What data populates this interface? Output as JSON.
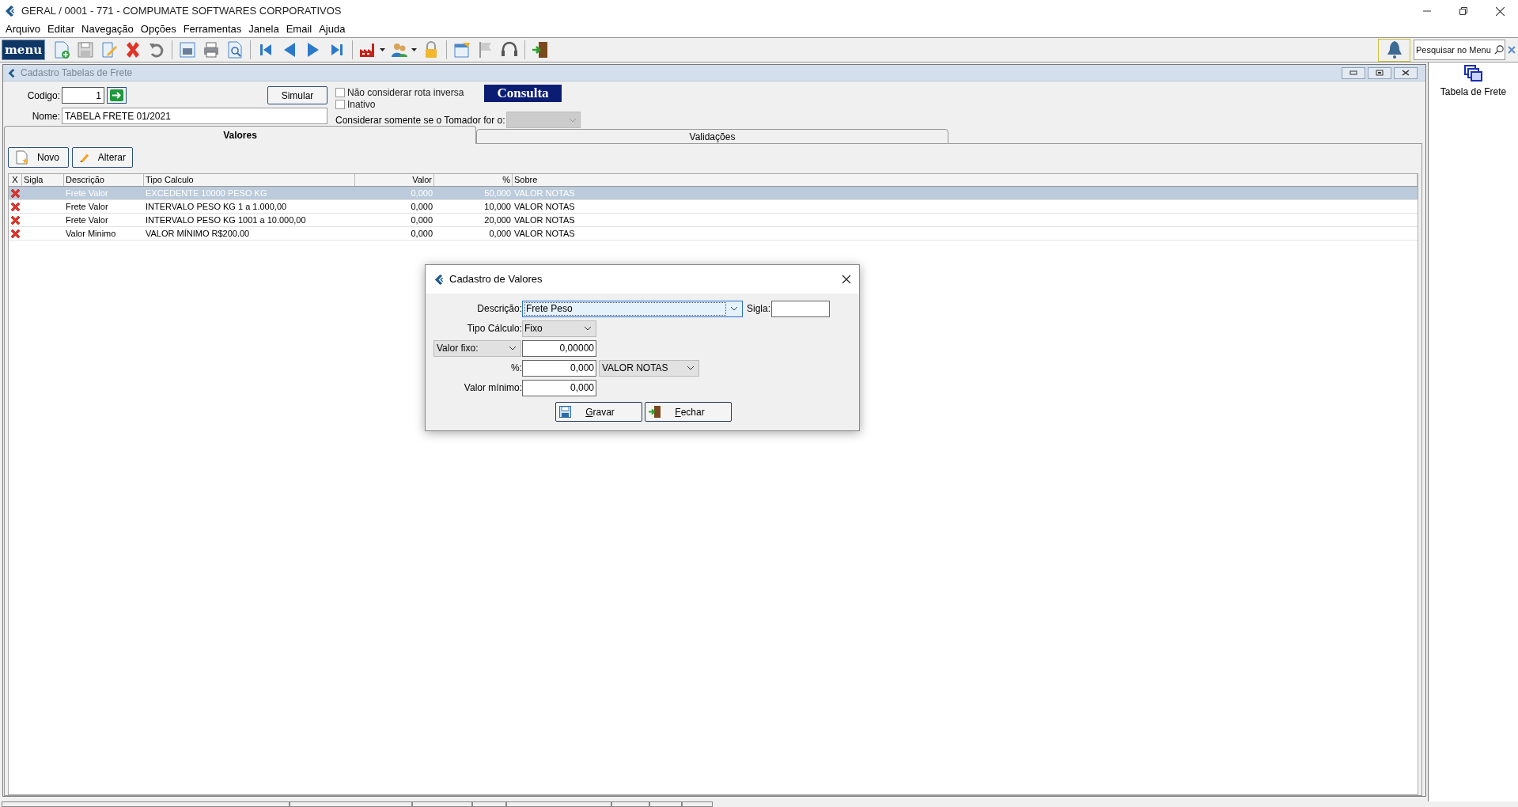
{
  "window": {
    "title": "GERAL / 0001 - 771 - COMPUMATE SOFTWARES CORPORATIVOS"
  },
  "menu": [
    "Arquivo",
    "Editar",
    "Navegação",
    "Opções",
    "Ferramentas",
    "Janela",
    "Email",
    "Ajuda"
  ],
  "toolbar": {
    "menu_button": "menu",
    "search": {
      "placeholder": "Pesquisar no Menu"
    }
  },
  "side_panel": {
    "items": [
      {
        "label": "Tabela de Frete"
      }
    ]
  },
  "child_window": {
    "title": "Cadastro Tabelas de Frete",
    "codigo": {
      "label": "Codigo:",
      "value": "1"
    },
    "nome": {
      "label": "Nome:",
      "value": "TABELA FRETE 01/2021"
    },
    "simular": "Simular",
    "options": [
      {
        "label": "Não considerar rota inversa",
        "checked": false
      },
      {
        "label": "Inativo",
        "checked": false
      }
    ],
    "mode_badge": "Consulta",
    "tomador": {
      "label": "Considerar somente se o Tomador for o:",
      "disabled": true
    },
    "tabs": [
      {
        "label": "Valores",
        "selected": true
      },
      {
        "label": "Validações",
        "selected": false
      }
    ],
    "buttons": [
      "Novo",
      "Alterar"
    ],
    "table": {
      "columns": [
        "X",
        "Sigla",
        "Descrição",
        "Tipo Calculo",
        "Valor",
        "%",
        "Sobre"
      ],
      "rows": [
        {
          "sigla": "",
          "descricao": "Frete Valor",
          "tipo": "EXCEDENTE 10000 PESO KG",
          "valor": "0,000",
          "pct": "50,000",
          "sobre": "VALOR NOTAS",
          "selected": true
        },
        {
          "sigla": "",
          "descricao": "Frete Valor",
          "tipo": "INTERVALO PESO KG 1 a 1.000,00",
          "valor": "0,000",
          "pct": "10,000",
          "sobre": "VALOR NOTAS",
          "selected": false
        },
        {
          "sigla": "",
          "descricao": "Frete Valor",
          "tipo": "INTERVALO PESO KG 1001 a 10.000,00",
          "valor": "0,000",
          "pct": "20,000",
          "sobre": "VALOR NOTAS",
          "selected": false
        },
        {
          "sigla": "",
          "descricao": "Valor Minimo",
          "tipo": "VALOR MÍNIMO R$200.00",
          "valor": "0,000",
          "pct": "0,000",
          "sobre": "VALOR NOTAS",
          "selected": false
        }
      ]
    }
  },
  "dialog": {
    "title": "Cadastro de Valores",
    "descricao": {
      "label": "Descrição:",
      "value": "Frete Peso"
    },
    "sigla": {
      "label": "Sigla:"
    },
    "tipo_calculo": {
      "label": "Tipo Cálculo:",
      "value": "Fixo"
    },
    "valor_fixo": {
      "option": "Valor fixo:",
      "value": "0,00000"
    },
    "percent": {
      "label": "%:",
      "value": "0,000",
      "base": "VALOR NOTAS"
    },
    "valor_minimo": {
      "label": "Valor mínimo:",
      "value": "0,000"
    },
    "buttons": [
      "Gravar",
      "Fechar"
    ]
  }
}
